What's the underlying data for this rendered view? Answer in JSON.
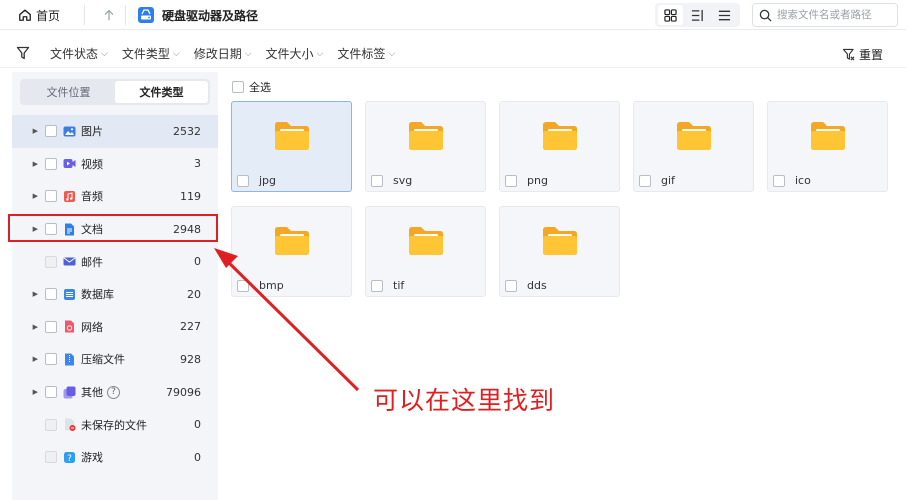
{
  "topbar": {
    "home_label": "首页",
    "drive_title": "硬盘驱动器及路径",
    "search_placeholder": "搜索文件名或者路径"
  },
  "filterbar": {
    "filters": [
      "文件状态",
      "文件类型",
      "修改日期",
      "文件大小",
      "文件标签"
    ],
    "reset_label": "重置"
  },
  "sidebar": {
    "tabs": [
      "文件位置",
      "文件类型"
    ],
    "active_tab": 1,
    "categories": [
      {
        "label": "图片",
        "count": "2532",
        "expandable": true,
        "enabled": true,
        "selected": true,
        "icon": "image-icon",
        "color": "#3b7de0"
      },
      {
        "label": "视频",
        "count": "3",
        "expandable": true,
        "enabled": true,
        "icon": "video-icon",
        "color": "#6a5be8"
      },
      {
        "label": "音频",
        "count": "119",
        "expandable": true,
        "enabled": true,
        "icon": "audio-icon",
        "color": "#ee5a4f"
      },
      {
        "label": "文档",
        "count": "2948",
        "expandable": true,
        "enabled": true,
        "highlighted": true,
        "icon": "document-icon",
        "color": "#2f7ef0"
      },
      {
        "label": "邮件",
        "count": "0",
        "expandable": false,
        "enabled": false,
        "icon": "mail-icon",
        "color": "#4c63d8"
      },
      {
        "label": "数据库",
        "count": "20",
        "expandable": true,
        "enabled": true,
        "icon": "database-icon",
        "color": "#3b86e8"
      },
      {
        "label": "网络",
        "count": "227",
        "expandable": true,
        "enabled": true,
        "icon": "network-icon",
        "color": "#ef5a6a"
      },
      {
        "label": "压缩文件",
        "count": "928",
        "expandable": true,
        "enabled": true,
        "icon": "archive-icon",
        "color": "#3b86e8"
      },
      {
        "label": "其他",
        "count": "79096",
        "expandable": true,
        "enabled": true,
        "help": "?",
        "icon": "other-icon",
        "color": "#6a5be8"
      },
      {
        "label": "未保存的文件",
        "count": "0",
        "expandable": false,
        "enabled": false,
        "icon": "unsaved-file-icon",
        "color": "#9aa3ad"
      },
      {
        "label": "游戏",
        "count": "0",
        "expandable": false,
        "enabled": false,
        "icon": "game-icon",
        "color": "#2f9ef0"
      }
    ]
  },
  "main": {
    "select_all_label": "全选",
    "folders": [
      {
        "name": "jpg",
        "selected": true
      },
      {
        "name": "svg"
      },
      {
        "name": "png"
      },
      {
        "name": "gif"
      },
      {
        "name": "ico"
      },
      {
        "name": "bmp"
      },
      {
        "name": "tif"
      },
      {
        "name": "dds"
      }
    ]
  },
  "annotation": {
    "text": "可以在这里找到",
    "color": "#e02020"
  }
}
